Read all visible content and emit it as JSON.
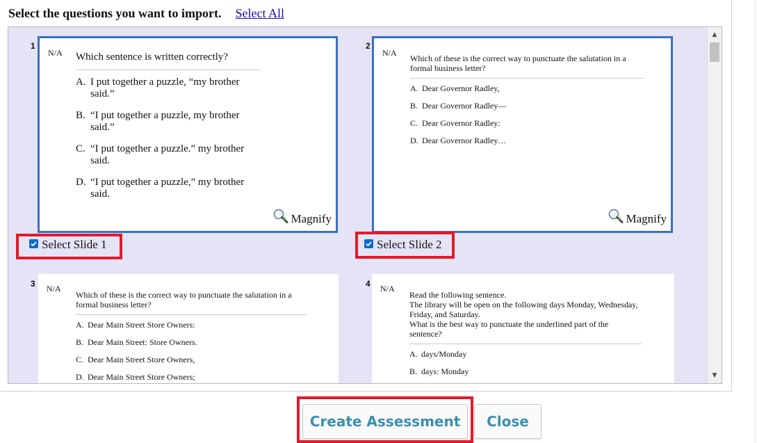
{
  "header": {
    "title": "Select the questions you want to import.",
    "select_all_label": "Select All"
  },
  "slides": [
    {
      "number": "1",
      "status": "N/A",
      "stem": "Which sentence is written correctly?",
      "options": [
        {
          "letter": "A.",
          "text": "I put together a puzzle, “my brother said.”"
        },
        {
          "letter": "B.",
          "text": "“I put together a puzzle, my brother said.”"
        },
        {
          "letter": "C.",
          "text": "“I put together a puzzle.” my brother said."
        },
        {
          "letter": "D.",
          "text": "“I put together a puzzle,” my brother said."
        }
      ],
      "magnify_label": "Magnify",
      "select_label": "Select Slide 1",
      "selected": true
    },
    {
      "number": "2",
      "status": "N/A",
      "stem": "Which of these is the correct way to punctuate the salutation in a formal business letter?",
      "options": [
        {
          "letter": "A.",
          "text": "Dear Governor Radley,"
        },
        {
          "letter": "B.",
          "text": "Dear Governor Radley—"
        },
        {
          "letter": "C.",
          "text": "Dear Governor Radley:"
        },
        {
          "letter": "D.",
          "text": "Dear Governor Radley…"
        }
      ],
      "magnify_label": "Magnify",
      "select_label": "Select Slide 2",
      "selected": true
    },
    {
      "number": "3",
      "status": "N/A",
      "stem": "Which of these is the correct way to punctuate the salutation in a formal business letter?",
      "options": [
        {
          "letter": "A.",
          "text": "Dear Main Street Store Owners:"
        },
        {
          "letter": "B.",
          "text": "Dear Main Street: Store Owners."
        },
        {
          "letter": "C.",
          "text": "Dear Main Street Store Owners,"
        },
        {
          "letter": "D.",
          "text": "Dear Main Street Store Owners;"
        }
      ]
    },
    {
      "number": "4",
      "status": "N/A",
      "stem_lines": [
        "Read the following sentence.",
        "The library will be open on the following days Monday, Wednesday, Friday, and Saturday.",
        "What is the best way to punctuate the underlined part of the sentence?"
      ],
      "options": [
        {
          "letter": "A.",
          "text": "days/Monday"
        },
        {
          "letter": "B.",
          "text": "days: Monday"
        }
      ]
    }
  ],
  "buttons": {
    "create": "Create Assessment",
    "close": "Close"
  },
  "colors": {
    "highlight": "#e01b2a",
    "card_border": "#3a6ec8",
    "panel_bg": "#e4e4f6",
    "button_text": "#3b8fae",
    "checkbox": "#0b6bcf"
  }
}
